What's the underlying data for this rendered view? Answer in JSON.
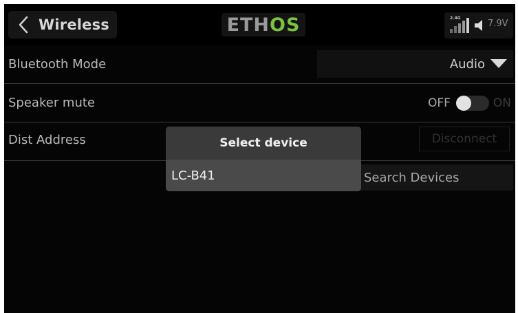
{
  "header": {
    "title": "Wireless",
    "logo": {
      "part1": "ETH",
      "part2": "OS"
    },
    "status": {
      "band": "2.4G",
      "voltage": "7.9V"
    }
  },
  "rows": [
    {
      "label": "Bluetooth Mode",
      "value": "Audio"
    },
    {
      "label": "Speaker mute",
      "off_label": "OFF",
      "on_label": "ON",
      "state": "off"
    },
    {
      "label": "Dist Address",
      "button": "Disconnect"
    }
  ],
  "search_button": "Search Devices",
  "modal": {
    "title": "Select device",
    "items": [
      "LC-B41"
    ]
  },
  "colors": {
    "accent": "#7bc142",
    "background": "#050505",
    "modal_header": "#3a3a3a",
    "modal_item": "#4a4a4a"
  },
  "icons": {
    "back": "chevron-left-icon",
    "signal": "signal-bars-icon",
    "speaker": "speaker-icon",
    "dropdown": "caret-down-icon"
  }
}
